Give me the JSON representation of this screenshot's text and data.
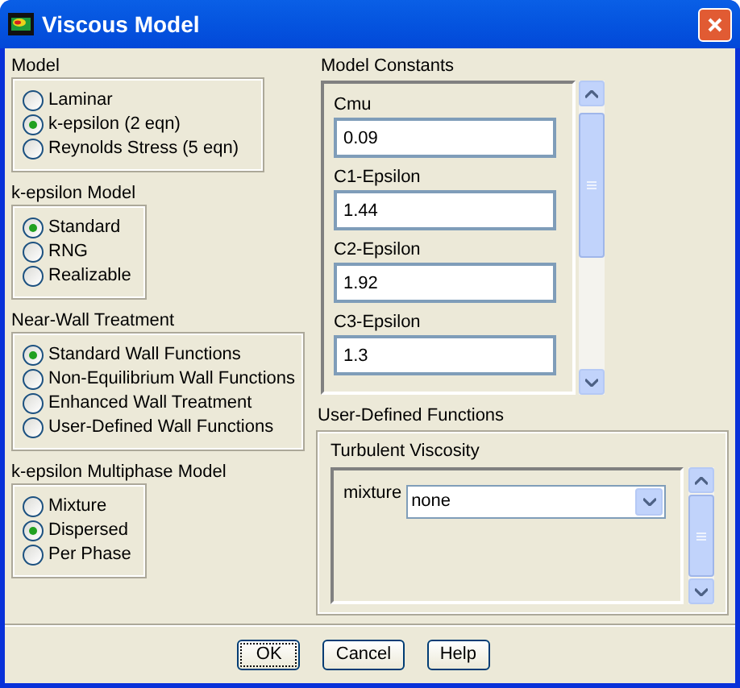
{
  "window": {
    "title": "Viscous Model"
  },
  "groups": [
    {
      "title": "Model",
      "options": [
        {
          "label": "Laminar",
          "selected": false
        },
        {
          "label": "k-epsilon (2 eqn)",
          "selected": true
        },
        {
          "label": "Reynolds Stress (5 eqn)",
          "selected": false
        }
      ]
    },
    {
      "title": "k-epsilon Model",
      "options": [
        {
          "label": "Standard",
          "selected": true
        },
        {
          "label": "RNG",
          "selected": false
        },
        {
          "label": "Realizable",
          "selected": false
        }
      ]
    },
    {
      "title": "Near-Wall Treatment",
      "options": [
        {
          "label": "Standard Wall Functions",
          "selected": true
        },
        {
          "label": "Non-Equilibrium Wall Functions",
          "selected": false
        },
        {
          "label": "Enhanced Wall Treatment",
          "selected": false
        },
        {
          "label": "User-Defined Wall Functions",
          "selected": false
        }
      ]
    },
    {
      "title": "k-epsilon Multiphase Model",
      "options": [
        {
          "label": "Mixture",
          "selected": false
        },
        {
          "label": "Dispersed",
          "selected": true
        },
        {
          "label": "Per Phase",
          "selected": false
        }
      ]
    }
  ],
  "model_constants": {
    "title": "Model Constants",
    "fields": [
      {
        "label": "Cmu",
        "value": "0.09"
      },
      {
        "label": "C1-Epsilon",
        "value": "1.44"
      },
      {
        "label": "C2-Epsilon",
        "value": "1.92"
      },
      {
        "label": "C3-Epsilon",
        "value": "1.3"
      }
    ]
  },
  "user_defined_functions": {
    "title": "User-Defined Functions",
    "turbulent_viscosity": {
      "title": "Turbulent Viscosity",
      "rows": [
        {
          "label": "mixture",
          "value": "none"
        }
      ]
    }
  },
  "buttons": [
    {
      "label": "OK",
      "focused": true
    },
    {
      "label": "Cancel",
      "focused": false
    },
    {
      "label": "Help",
      "focused": false
    }
  ]
}
